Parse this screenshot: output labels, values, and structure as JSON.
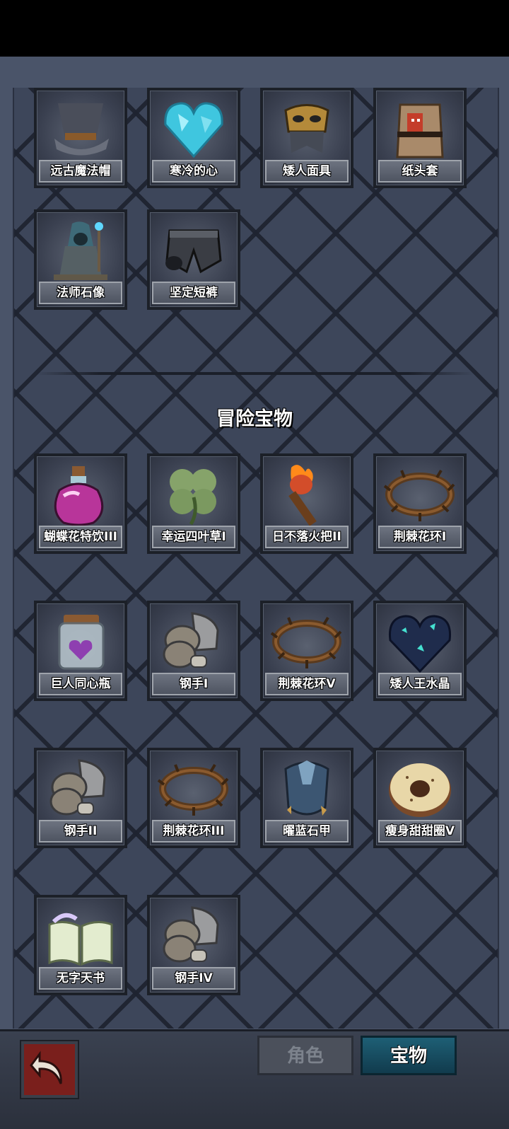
{
  "section": {
    "title": "冒险宝物"
  },
  "top_items": [
    {
      "label": "远古魔法帽",
      "icon": "wizard-hat-icon"
    },
    {
      "label": "寒冷的心",
      "icon": "ice-heart-icon"
    },
    {
      "label": "矮人面具",
      "icon": "dwarf-mask-icon"
    },
    {
      "label": "纸头套",
      "icon": "paper-bag-icon"
    },
    {
      "label": "法师石像",
      "icon": "mage-statue-icon"
    },
    {
      "label": "坚定短裤",
      "icon": "shorts-icon"
    }
  ],
  "adventure_items": [
    {
      "label": "蝴蝶花特饮III",
      "icon": "potion-icon"
    },
    {
      "label": "幸运四叶草I",
      "icon": "four-leaf-clover-icon"
    },
    {
      "label": "日不落火把II",
      "icon": "torch-icon"
    },
    {
      "label": "荆棘花环I",
      "icon": "thorn-wreath-icon"
    },
    {
      "label": "巨人同心瓶",
      "icon": "heart-jar-icon"
    },
    {
      "label": "钢手I",
      "icon": "steel-gauntlet-icon"
    },
    {
      "label": "荆棘花环V",
      "icon": "thorn-wreath-icon"
    },
    {
      "label": "矮人王水晶",
      "icon": "crystal-heart-icon"
    },
    {
      "label": "钢手II",
      "icon": "steel-gauntlet-icon"
    },
    {
      "label": "荆棘花环III",
      "icon": "thorn-wreath-icon"
    },
    {
      "label": "曜蓝石甲",
      "icon": "blue-armor-icon"
    },
    {
      "label": "瘦身甜甜圈V",
      "icon": "donut-icon"
    },
    {
      "label": "无字天书",
      "icon": "blank-book-icon"
    },
    {
      "label": "钢手IV",
      "icon": "steel-gauntlet-icon"
    }
  ],
  "tabs": {
    "role_label": "角色",
    "treasure_label": "宝物"
  },
  "colors": {
    "active_tab": "#1e5f75",
    "inactive_tab": "#4b505b",
    "back_button": "#7a1f1c"
  }
}
